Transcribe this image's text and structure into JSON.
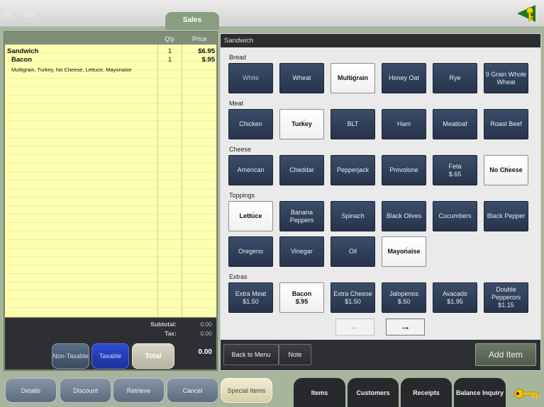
{
  "header": {
    "active_tab": "Sales"
  },
  "order": {
    "col_qty": "Qty",
    "col_price": "Price",
    "lines": [
      {
        "name": "Sandwich",
        "qty": "1",
        "price": "$6.95"
      },
      {
        "name": "Bacon",
        "qty": "1",
        "price": "$.95"
      },
      {
        "name": "Multigrain, Turkey, No Cheese, Lettuce, Mayonaise",
        "qty": "",
        "price": ""
      }
    ],
    "subtotal_label": "Subtotal:",
    "subtotal_value": "0.00",
    "tax_label": "Tax:",
    "tax_value": "0.00",
    "total_value": "0.00",
    "non_taxable_label": "Non-Taxable",
    "taxable_label": "Taxable",
    "total_label": "Total"
  },
  "item_panel": {
    "title": "Sandwich",
    "sections": [
      {
        "label": "Bread",
        "options": [
          {
            "label": "White",
            "selected": false,
            "dim": true
          },
          {
            "label": "Wheat",
            "selected": false
          },
          {
            "label": "Multigrain",
            "selected": true
          },
          {
            "label": "Honey Oat",
            "selected": false
          },
          {
            "label": "Rye",
            "selected": false
          },
          {
            "label": "9 Grain Whole Wheat",
            "selected": false
          }
        ]
      },
      {
        "label": "Meat",
        "options": [
          {
            "label": "Chicken",
            "selected": false
          },
          {
            "label": "Turkey",
            "selected": true
          },
          {
            "label": "BLT",
            "selected": false
          },
          {
            "label": "Ham",
            "selected": false
          },
          {
            "label": "Meatloaf",
            "selected": false
          },
          {
            "label": "Roast Beef",
            "selected": false
          }
        ]
      },
      {
        "label": "Cheese",
        "options": [
          {
            "label": "American",
            "selected": false
          },
          {
            "label": "Cheddar",
            "selected": false
          },
          {
            "label": "Pepperjack",
            "selected": false
          },
          {
            "label": "Provolone",
            "selected": false
          },
          {
            "label": "Feta",
            "price": "$.65",
            "selected": false
          },
          {
            "label": "No Cheese",
            "selected": true
          }
        ]
      },
      {
        "label": "Toppings",
        "options": [
          {
            "label": "Lettuce",
            "selected": true
          },
          {
            "label": "Banana Peppers",
            "selected": false
          },
          {
            "label": "Spinach",
            "selected": false
          },
          {
            "label": "Black Olives",
            "selected": false
          },
          {
            "label": "Cucumbers",
            "selected": false
          },
          {
            "label": "Black Pepper",
            "selected": false
          },
          {
            "label": "Oregeno",
            "selected": false
          },
          {
            "label": "Vinegar",
            "selected": false
          },
          {
            "label": "Oil",
            "selected": false
          },
          {
            "label": "Mayonaise",
            "selected": true
          }
        ]
      },
      {
        "label": "Extras",
        "options": [
          {
            "label": "Extra Meat",
            "price": "$1.50",
            "selected": false
          },
          {
            "label": "Bacon",
            "price": "$.95",
            "selected": true
          },
          {
            "label": "Extra Cheese",
            "price": "$1.50",
            "selected": false
          },
          {
            "label": "Jalopenos",
            "price": "$.50",
            "selected": false
          },
          {
            "label": "Avacado",
            "price": "$1.95",
            "selected": false
          },
          {
            "label": "Double Pepperoni",
            "price": "$1.15",
            "selected": false
          }
        ]
      }
    ],
    "prev_arrow": "←",
    "next_arrow": "→",
    "back_to_menu": "Back to Menu",
    "note": "Note",
    "add_item": "Add Item"
  },
  "footer": {
    "buttons": [
      "Details",
      "Discount",
      "Retrieve",
      "Cancel",
      "Special Items"
    ],
    "tabs": [
      "Items",
      "Customers",
      "Receipts",
      "Balance Inquiry"
    ]
  },
  "colors": {
    "accent_green": "#8a9f80",
    "button_navy": "#2f3e58",
    "ticket_yellow": "#ffffb0",
    "taxable_blue": "#2440c0"
  },
  "icons": {
    "top_right": "key-icon",
    "bottom_right": "key-icon",
    "selected_mark": "check-icon"
  }
}
